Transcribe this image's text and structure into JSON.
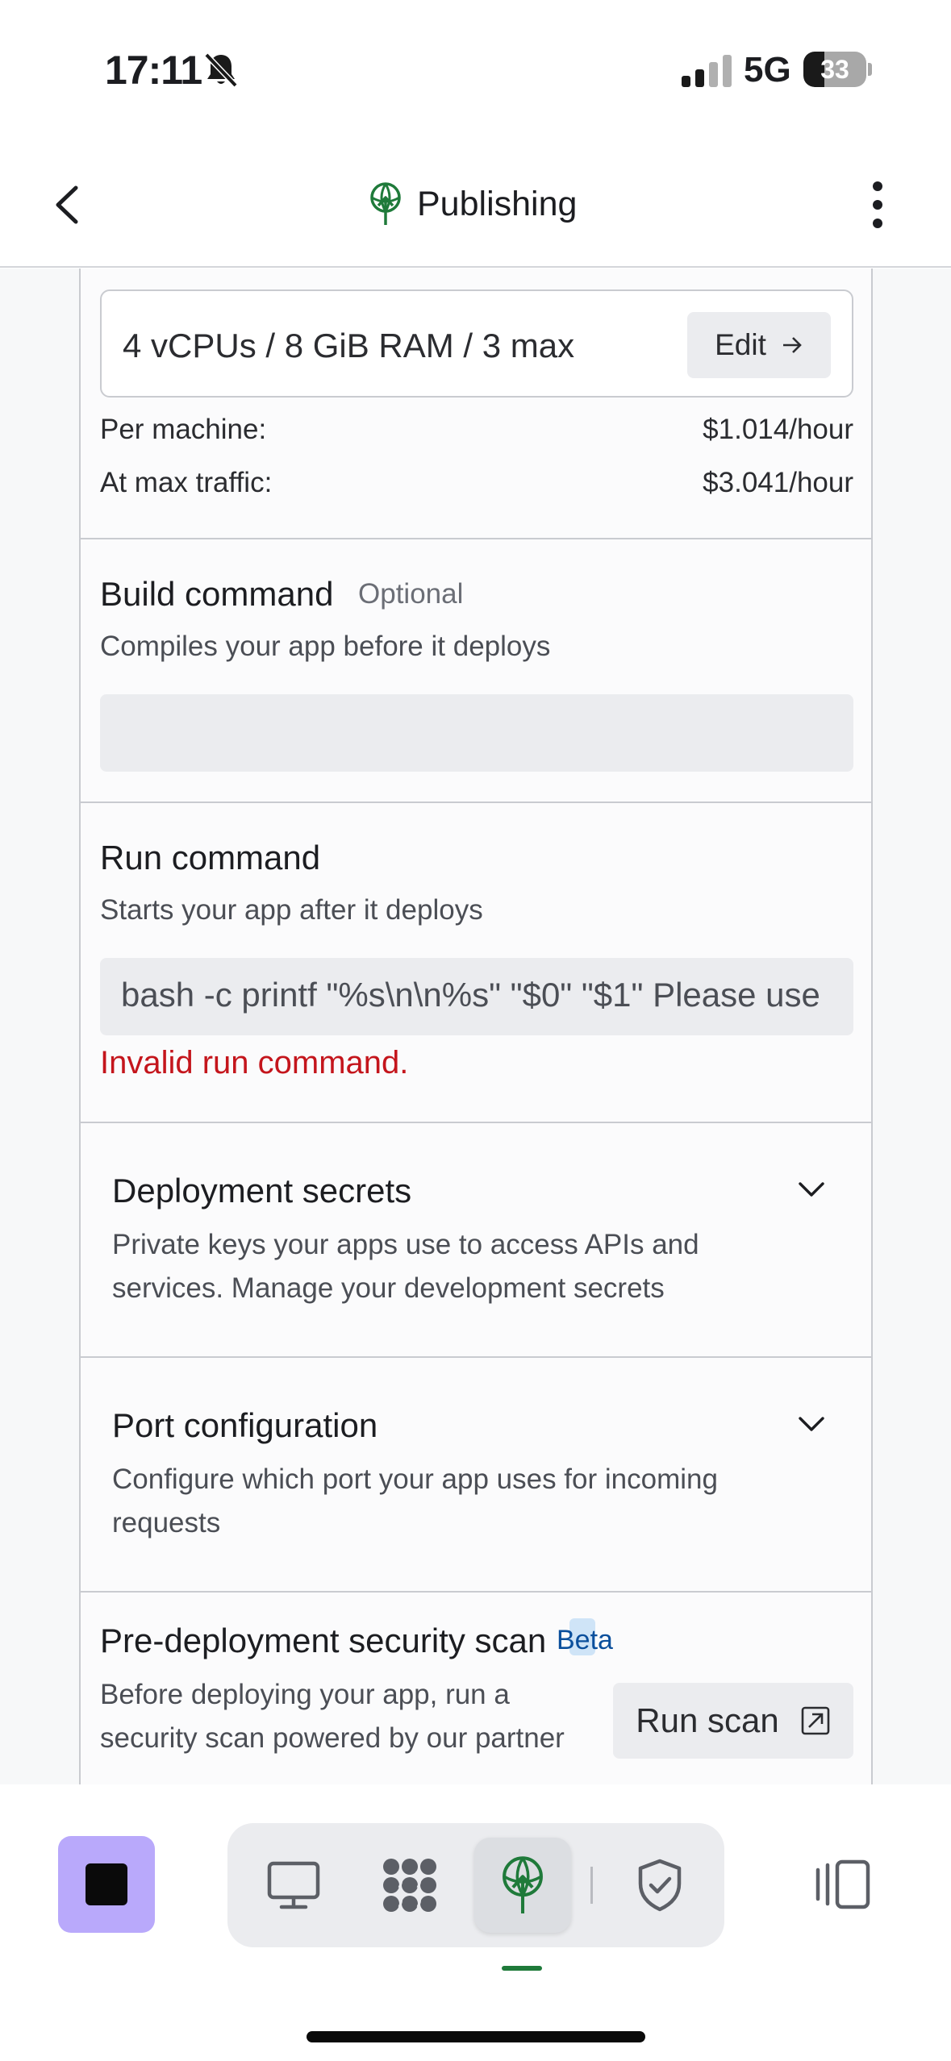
{
  "status_bar": {
    "time": "17:11",
    "network": "5G",
    "battery_percent": 33,
    "battery_label": "33"
  },
  "header": {
    "title": "Publishing"
  },
  "machine": {
    "config": "4 vCPUs / 8 GiB RAM / 3 max",
    "edit_label": "Edit",
    "per_machine_label": "Per machine:",
    "per_machine_value": "$1.014/hour",
    "max_traffic_label": "At max traffic:",
    "max_traffic_value": "$3.041/hour"
  },
  "build_command": {
    "title": "Build command",
    "optional": "Optional",
    "description": "Compiles your app before it deploys",
    "value": ""
  },
  "run_command": {
    "title": "Run command",
    "description": "Starts your app after it deploys",
    "value": "bash -c printf \"%s\\n\\n%s\" \"$0\" \"$1\" Please use",
    "error": "Invalid run command."
  },
  "deployment_secrets": {
    "title": "Deployment secrets",
    "description_line1": "Private keys your apps use to access APIs and",
    "description_line2": "services. Manage your development secrets"
  },
  "port_configuration": {
    "title": "Port configuration",
    "description_line1": "Configure which port your app uses for incoming",
    "description_line2": "requests"
  },
  "security_scan": {
    "title": "Pre-deployment security scan",
    "badge": "Beta",
    "description_line1": "Before deploying your app, run a",
    "description_line2": "security scan powered by our partner",
    "button_label": "Run scan"
  },
  "bottom_nav": {
    "tabs": [
      "preview-icon",
      "workflows-icon",
      "publishing-icon",
      "security-icon"
    ],
    "active_tab": "publishing-icon"
  },
  "colors": {
    "accent": "#1f7a3a",
    "error": "#c4151c",
    "stop_button": "#b9a9fb",
    "beta": "#0b4f9c"
  }
}
